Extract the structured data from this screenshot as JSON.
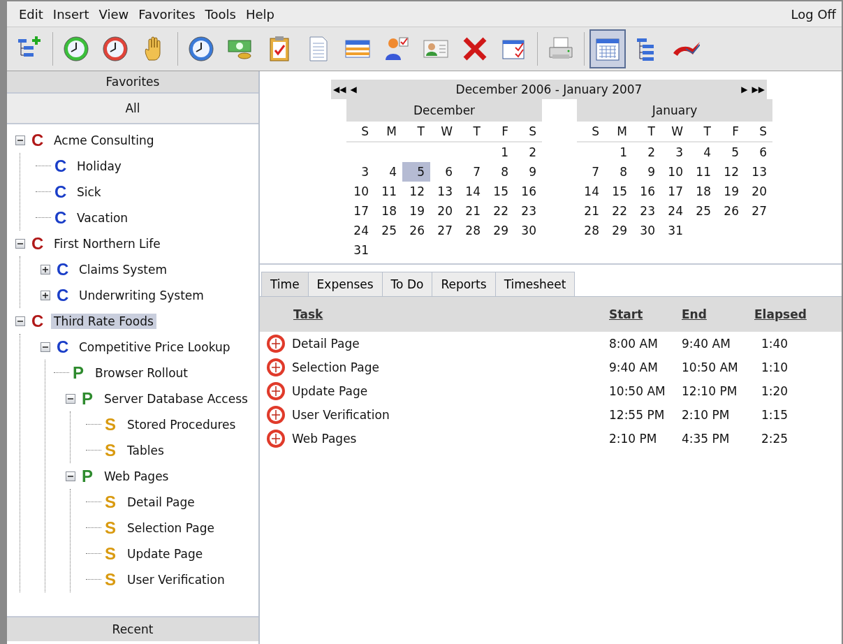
{
  "menu": {
    "items": [
      "Edit",
      "Insert",
      "View",
      "Favorites",
      "Tools",
      "Help"
    ],
    "log_off": "Log Off"
  },
  "toolbar": [
    {
      "kind": "tree-add",
      "selected": false
    },
    {
      "kind": "separator"
    },
    {
      "kind": "clock-green",
      "selected": false
    },
    {
      "kind": "clock-red",
      "selected": false
    },
    {
      "kind": "hand",
      "selected": false
    },
    {
      "kind": "separator"
    },
    {
      "kind": "clock-blue",
      "selected": false
    },
    {
      "kind": "money",
      "selected": false
    },
    {
      "kind": "clipboard",
      "selected": false
    },
    {
      "kind": "document",
      "selected": false
    },
    {
      "kind": "grid",
      "selected": false
    },
    {
      "kind": "person-check",
      "selected": false
    },
    {
      "kind": "contact-card",
      "selected": false
    },
    {
      "kind": "delete",
      "selected": false
    },
    {
      "kind": "window-check",
      "selected": false
    },
    {
      "kind": "separator"
    },
    {
      "kind": "printer",
      "selected": false
    },
    {
      "kind": "separator"
    },
    {
      "kind": "calendar",
      "selected": true
    },
    {
      "kind": "tree",
      "selected": false
    },
    {
      "kind": "logo",
      "selected": false
    }
  ],
  "sidebar": {
    "header": "Favorites",
    "filter": "All",
    "footer": "Recent",
    "tree": [
      {
        "letter": "C",
        "color": "#b01818",
        "label": "Acme Consulting",
        "expanded": true,
        "selected": false,
        "children": [
          {
            "letter": "C",
            "color": "#1a3ec8",
            "label": "Holiday",
            "selected": false
          },
          {
            "letter": "C",
            "color": "#1a3ec8",
            "label": "Sick",
            "selected": false
          },
          {
            "letter": "C",
            "color": "#1a3ec8",
            "label": "Vacation",
            "selected": false
          }
        ]
      },
      {
        "letter": "C",
        "color": "#b01818",
        "label": "First Northern Life",
        "expanded": true,
        "selected": false,
        "children": [
          {
            "letter": "C",
            "color": "#1a3ec8",
            "label": "Claims System",
            "expanded": false,
            "selected": false
          },
          {
            "letter": "C",
            "color": "#1a3ec8",
            "label": "Underwriting System",
            "expanded": false,
            "selected": false
          }
        ]
      },
      {
        "letter": "C",
        "color": "#b01818",
        "label": "Third Rate Foods",
        "expanded": true,
        "selected": true,
        "children": [
          {
            "letter": "C",
            "color": "#1a3ec8",
            "label": "Competitive Price Lookup",
            "expanded": true,
            "selected": false,
            "children": [
              {
                "letter": "P",
                "color": "#2e8b2e",
                "label": "Browser Rollout",
                "selected": false
              },
              {
                "letter": "P",
                "color": "#2e8b2e",
                "label": "Server Database Access",
                "expanded": true,
                "selected": false,
                "children": [
                  {
                    "letter": "S",
                    "color": "#d99a10",
                    "label": "Stored Procedures",
                    "selected": false
                  },
                  {
                    "letter": "S",
                    "color": "#d99a10",
                    "label": "Tables",
                    "selected": false
                  }
                ]
              },
              {
                "letter": "P",
                "color": "#2e8b2e",
                "label": "Web Pages",
                "expanded": true,
                "selected": false,
                "children": [
                  {
                    "letter": "S",
                    "color": "#d99a10",
                    "label": "Detail Page",
                    "selected": false
                  },
                  {
                    "letter": "S",
                    "color": "#d99a10",
                    "label": "Selection Page",
                    "selected": false
                  },
                  {
                    "letter": "S",
                    "color": "#d99a10",
                    "label": "Update Page",
                    "selected": false
                  },
                  {
                    "letter": "S",
                    "color": "#d99a10",
                    "label": "User Verification",
                    "selected": false
                  }
                ]
              }
            ]
          }
        ]
      }
    ]
  },
  "calendar": {
    "title": "December 2006 - January 2007",
    "nav": [
      "◀◀",
      "◀",
      "▶",
      "▶▶"
    ],
    "months": [
      {
        "name": "December",
        "weekdays": [
          "S",
          "M",
          "T",
          "W",
          "T",
          "F",
          "S"
        ],
        "weeks": [
          [
            {
              "kind": "blank"
            },
            {
              "kind": "blank"
            },
            {
              "kind": "blank"
            },
            {
              "kind": "blank"
            },
            {
              "kind": "blank"
            },
            {
              "kind": "day",
              "day": "1",
              "selected": false
            },
            {
              "kind": "day",
              "day": "2",
              "selected": false
            }
          ],
          [
            {
              "kind": "day",
              "day": "3",
              "selected": false
            },
            {
              "kind": "day",
              "day": "4",
              "selected": false
            },
            {
              "kind": "day",
              "day": "5",
              "selected": true
            },
            {
              "kind": "day",
              "day": "6",
              "selected": false
            },
            {
              "kind": "day",
              "day": "7",
              "selected": false
            },
            {
              "kind": "day",
              "day": "8",
              "selected": false
            },
            {
              "kind": "day",
              "day": "9",
              "selected": false
            }
          ],
          [
            {
              "kind": "day",
              "day": "10",
              "selected": false
            },
            {
              "kind": "day",
              "day": "11",
              "selected": false
            },
            {
              "kind": "day",
              "day": "12",
              "selected": false
            },
            {
              "kind": "day",
              "day": "13",
              "selected": false
            },
            {
              "kind": "day",
              "day": "14",
              "selected": false
            },
            {
              "kind": "day",
              "day": "15",
              "selected": false
            },
            {
              "kind": "day",
              "day": "16",
              "selected": false
            }
          ],
          [
            {
              "kind": "day",
              "day": "17",
              "selected": false
            },
            {
              "kind": "day",
              "day": "18",
              "selected": false
            },
            {
              "kind": "day",
              "day": "19",
              "selected": false
            },
            {
              "kind": "day",
              "day": "20",
              "selected": false
            },
            {
              "kind": "day",
              "day": "21",
              "selected": false
            },
            {
              "kind": "day",
              "day": "22",
              "selected": false
            },
            {
              "kind": "day",
              "day": "23",
              "selected": false
            }
          ],
          [
            {
              "kind": "day",
              "day": "24",
              "selected": false
            },
            {
              "kind": "day",
              "day": "25",
              "selected": false
            },
            {
              "kind": "day",
              "day": "26",
              "selected": false
            },
            {
              "kind": "day",
              "day": "27",
              "selected": false
            },
            {
              "kind": "day",
              "day": "28",
              "selected": false
            },
            {
              "kind": "day",
              "day": "29",
              "selected": false
            },
            {
              "kind": "day",
              "day": "30",
              "selected": false
            }
          ],
          [
            {
              "kind": "day",
              "day": "31",
              "selected": false
            }
          ]
        ]
      },
      {
        "name": "January",
        "weekdays": [
          "S",
          "M",
          "T",
          "W",
          "T",
          "F",
          "S"
        ],
        "weeks": [
          [
            {
              "kind": "blank"
            },
            {
              "kind": "day",
              "day": "1",
              "selected": false
            },
            {
              "kind": "day",
              "day": "2",
              "selected": false
            },
            {
              "kind": "day",
              "day": "3",
              "selected": false
            },
            {
              "kind": "day",
              "day": "4",
              "selected": false
            },
            {
              "kind": "day",
              "day": "5",
              "selected": false
            },
            {
              "kind": "day",
              "day": "6",
              "selected": false
            }
          ],
          [
            {
              "kind": "day",
              "day": "7",
              "selected": false
            },
            {
              "kind": "day",
              "day": "8",
              "selected": false
            },
            {
              "kind": "day",
              "day": "9",
              "selected": false
            },
            {
              "kind": "day",
              "day": "10",
              "selected": false
            },
            {
              "kind": "day",
              "day": "11",
              "selected": false
            },
            {
              "kind": "day",
              "day": "12",
              "selected": false
            },
            {
              "kind": "day",
              "day": "13",
              "selected": false
            }
          ],
          [
            {
              "kind": "day",
              "day": "14",
              "selected": false
            },
            {
              "kind": "day",
              "day": "15",
              "selected": false
            },
            {
              "kind": "day",
              "day": "16",
              "selected": false
            },
            {
              "kind": "day",
              "day": "17",
              "selected": false
            },
            {
              "kind": "day",
              "day": "18",
              "selected": false
            },
            {
              "kind": "day",
              "day": "19",
              "selected": false
            },
            {
              "kind": "day",
              "day": "20",
              "selected": false
            }
          ],
          [
            {
              "kind": "day",
              "day": "21",
              "selected": false
            },
            {
              "kind": "day",
              "day": "22",
              "selected": false
            },
            {
              "kind": "day",
              "day": "23",
              "selected": false
            },
            {
              "kind": "day",
              "day": "24",
              "selected": false
            },
            {
              "kind": "day",
              "day": "25",
              "selected": false
            },
            {
              "kind": "day",
              "day": "26",
              "selected": false
            },
            {
              "kind": "day",
              "day": "27",
              "selected": false
            }
          ],
          [
            {
              "kind": "day",
              "day": "28",
              "selected": false
            },
            {
              "kind": "day",
              "day": "29",
              "selected": false
            },
            {
              "kind": "day",
              "day": "30",
              "selected": false
            },
            {
              "kind": "day",
              "day": "31",
              "selected": false
            }
          ]
        ]
      }
    ]
  },
  "tabs": [
    {
      "label": "Time",
      "selected": true
    },
    {
      "label": "Expenses",
      "selected": false
    },
    {
      "label": "To Do",
      "selected": false
    },
    {
      "label": "Reports",
      "selected": false
    },
    {
      "label": "Timesheet",
      "selected": false
    }
  ],
  "table": {
    "columns": [
      "Task",
      "Start",
      "End",
      "Elapsed"
    ],
    "rows": [
      {
        "task": "Detail Page",
        "start": "8:00 AM",
        "end": "9:40 AM",
        "elapsed": "1:40"
      },
      {
        "task": "Selection Page",
        "start": "9:40 AM",
        "end": "10:50 AM",
        "elapsed": "1:10"
      },
      {
        "task": "Update Page",
        "start": "10:50 AM",
        "end": "12:10 PM",
        "elapsed": "1:20"
      },
      {
        "task": "User Verification",
        "start": "12:55 PM",
        "end": "2:10 PM",
        "elapsed": "1:15"
      },
      {
        "task": "Web Pages",
        "start": "2:10 PM",
        "end": "4:35 PM",
        "elapsed": "2:25"
      }
    ]
  }
}
